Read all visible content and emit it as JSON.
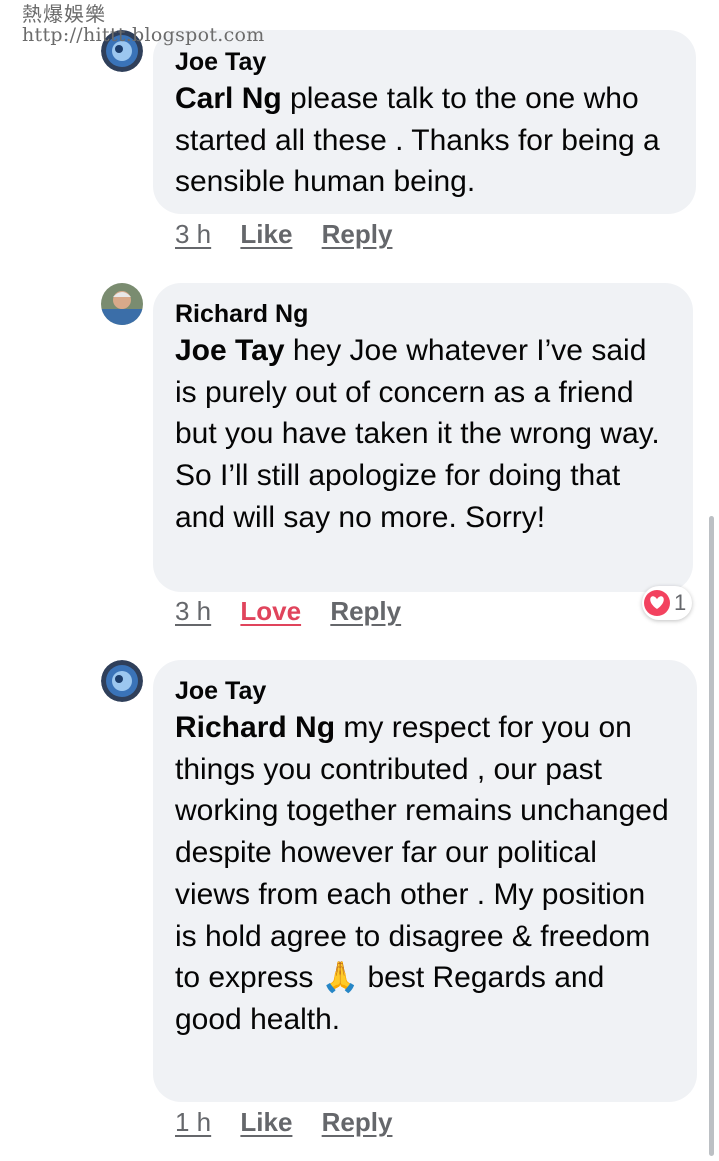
{
  "watermark": {
    "title": "熱爆娛樂",
    "url": "http://hittt.blogspot.com"
  },
  "comments": [
    {
      "author": "Joe Tay",
      "mention": "Carl Ng",
      "text_line1": "please talk to the one",
      "text_rest": "who started all these . Thanks for being a sensible human being.",
      "time": "3 h",
      "reaction_label": "Like",
      "reply_label": "Reply"
    },
    {
      "author": "Richard Ng",
      "mention": "Joe Tay",
      "text_line1": " hey Joe whatever I’ve",
      "text_rest": "said is purely out of concern as a friend but you have taken it the wrong way. So I’ll still apologize for doing that and will say no more. Sorry!",
      "time": "3 h",
      "reaction_label": "Love",
      "reply_label": "Reply",
      "reaction_count": "1"
    },
    {
      "author": "Joe Tay",
      "mention": "Richard Ng",
      "text_line1": "my respect for you",
      "text_rest": "on things you contributed , our past working together remains unchanged despite however far our political views from each other . My position is hold agree to disagree & freedom to express",
      "emoji": "🙏",
      "text_end": "best Regards and good health.",
      "time": "1 h",
      "reaction_label": "Like",
      "reply_label": "Reply"
    }
  ],
  "colors": {
    "bubble": "#f0f2f5",
    "love": "#e0445c",
    "meta": "#65676b"
  }
}
